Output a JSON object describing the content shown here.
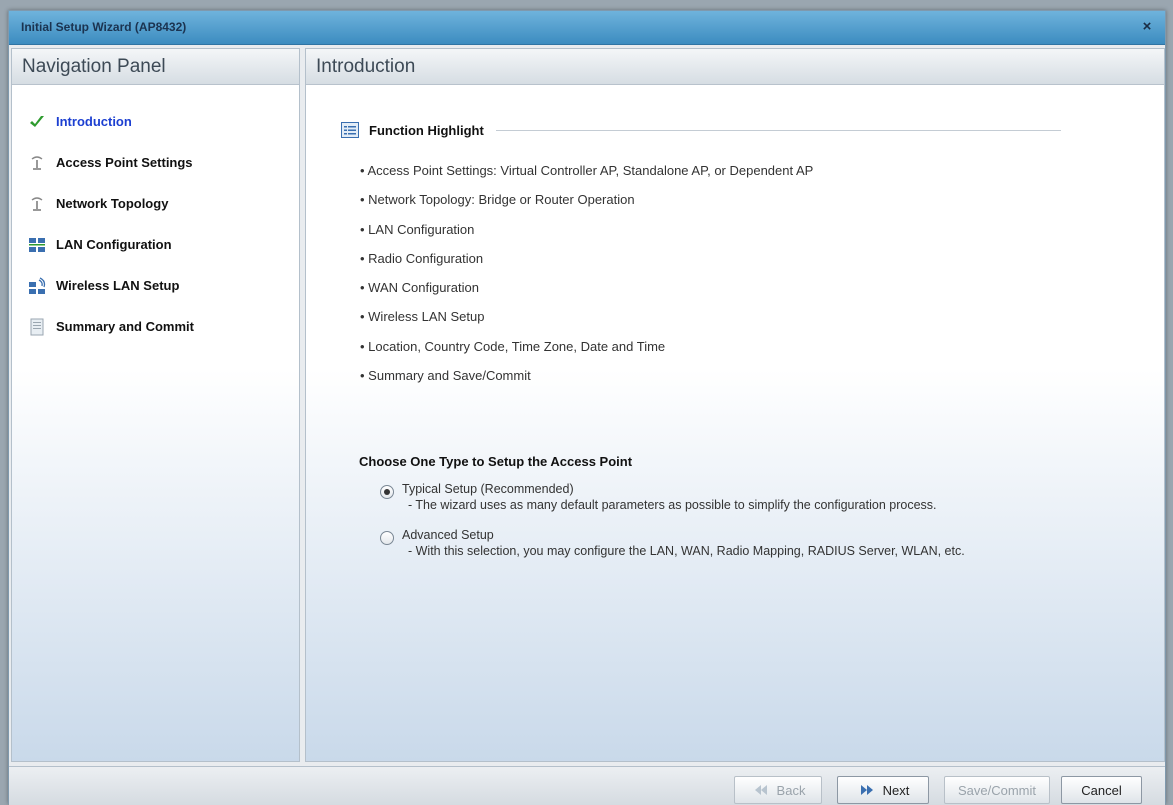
{
  "window": {
    "title": "Initial Setup Wizard (AP8432)",
    "close_glyph": "×"
  },
  "nav": {
    "header": "Navigation Panel",
    "items": [
      {
        "label": "Introduction",
        "icon": "checkmark-icon",
        "active": true
      },
      {
        "label": "Access Point Settings",
        "icon": "access-point-icon"
      },
      {
        "label": "Network Topology",
        "icon": "access-point-icon"
      },
      {
        "label": "LAN Configuration",
        "icon": "lan-icon"
      },
      {
        "label": "Wireless LAN Setup",
        "icon": "wireless-lan-icon"
      },
      {
        "label": "Summary and Commit",
        "icon": "document-icon"
      }
    ]
  },
  "main": {
    "header": "Introduction",
    "section_title": "Function Highlight",
    "bullets": [
      "• Access Point Settings: Virtual Controller AP, Standalone AP, or Dependent AP",
      "• Network Topology: Bridge or Router Operation",
      "• LAN Configuration",
      "• Radio Configuration",
      "• WAN Configuration",
      "• Wireless LAN Setup",
      "• Location, Country Code, Time Zone, Date and Time",
      "• Summary and Save/Commit"
    ],
    "choose_title": "Choose One Type to Setup the Access Point",
    "options": [
      {
        "label": "Typical Setup (Recommended)",
        "desc": "- The wizard uses as many default parameters as possible to simplify the configuration process.",
        "checked": true
      },
      {
        "label": "Advanced Setup",
        "desc": "- With this selection, you may configure the LAN, WAN, Radio Mapping, RADIUS Server, WLAN, etc.",
        "checked": false
      }
    ]
  },
  "footer": {
    "back_label": "Back",
    "next_label": "Next",
    "save_label": "Save/Commit",
    "cancel_label": "Cancel"
  },
  "colors": {
    "titlebar": "#3c8cc0",
    "active_nav": "#1c3fd1",
    "check_green": "#2e9b2e"
  }
}
